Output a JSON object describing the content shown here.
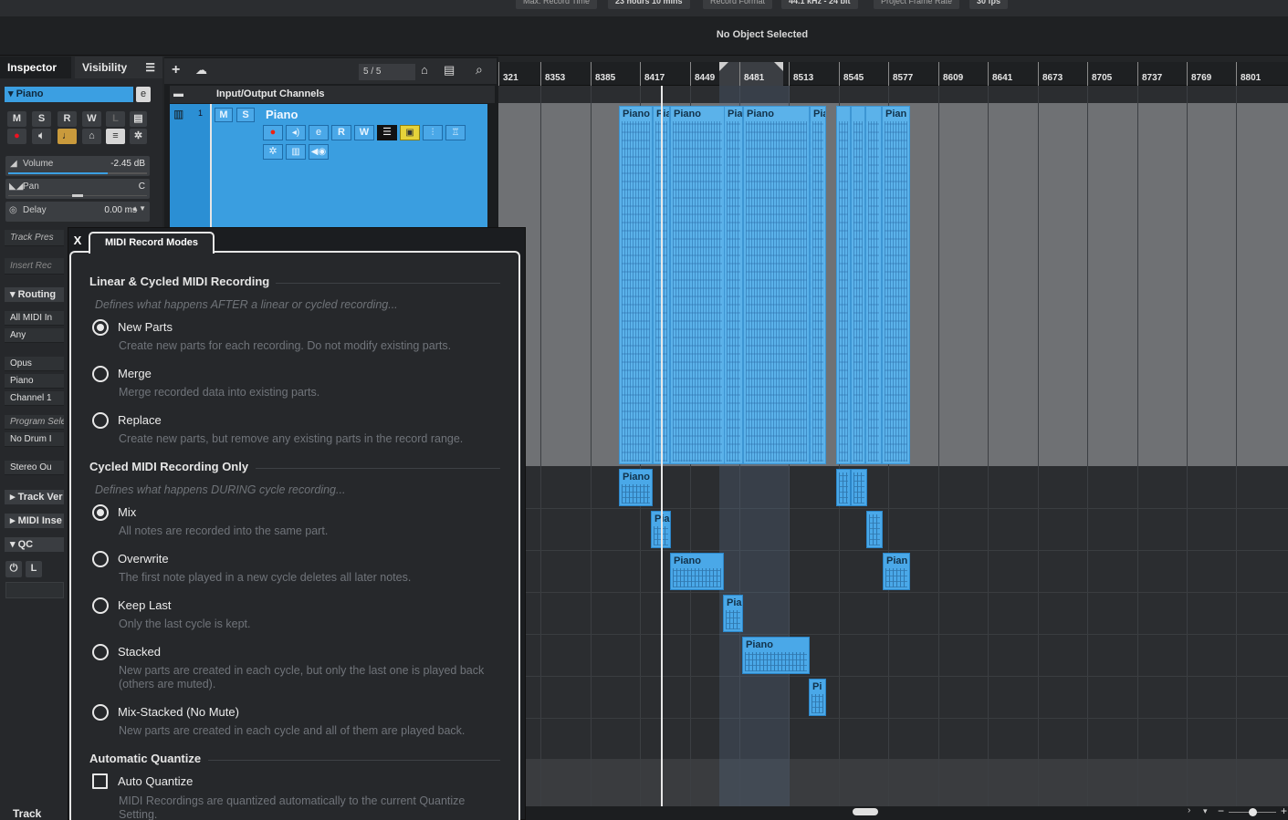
{
  "statusbar": {
    "items": [
      "Max. Record Time",
      "23 hours 10 mins",
      "Record Format",
      "44.1 kHz - 24 bit",
      "Project Frame Rate",
      "30 fps"
    ]
  },
  "infoline": {
    "text": "No Object Selected"
  },
  "inspector": {
    "tab_inspector": "Inspector",
    "tab_visibility": "Visibility",
    "track_name": "Piano",
    "buttons_row1": [
      "M",
      "S",
      "R",
      "W",
      "L"
    ],
    "volume_label": "Volume",
    "volume_value": "-2.45 dB",
    "pan_label": "Pan",
    "pan_value": "C",
    "delay_label": "Delay",
    "delay_value": "0.00 ms",
    "track_preset": "Track Pres",
    "insert_rec": "Insert Rec",
    "routing": "Routing",
    "midi_in": "All MIDI In",
    "channel_any": "Any",
    "opus": "Opus",
    "piano": "Piano",
    "channel1": "Channel 1",
    "program_select": "Program Sele",
    "no_drum": "No Drum I",
    "stereo_out": "Stereo Ou",
    "track_versions": "Track Ver",
    "midi_inserts": "MIDI Inse",
    "qc": "QC",
    "track_footer": "Track"
  },
  "tracklist": {
    "counter": "5 / 5",
    "folder_name": "Input/Output Channels",
    "track_number": "1",
    "track_name": "Piano",
    "m": "M",
    "s": "S",
    "r": "R",
    "w": "W"
  },
  "ruler": {
    "bars": [
      "321",
      "8353",
      "8385",
      "8417",
      "8449",
      "8481",
      "8513",
      "8545",
      "8577",
      "8609",
      "8641",
      "8673",
      "8705",
      "8737",
      "8769",
      "8801"
    ]
  },
  "parts": {
    "lane1": [
      "Piano",
      "Pia",
      "Piano",
      "Pia",
      "Piano",
      "Pia",
      "Pian"
    ],
    "lane2": [
      "Piano"
    ],
    "lane3": [
      "Pia"
    ],
    "lane4a": "Piano",
    "lane4b": "Pian",
    "lane5": "Pia",
    "lane6": "Piano",
    "lane7": "Pi"
  },
  "popup": {
    "close": "X",
    "tab": "MIDI Record Modes",
    "section1_title": "Linear & Cycled MIDI Recording",
    "section1_desc": "Defines what happens AFTER a linear or cycled recording...",
    "options1": [
      {
        "label": "New Parts",
        "hint": "Create new parts for each recording. Do not modify existing parts.",
        "selected": true
      },
      {
        "label": "Merge",
        "hint": "Merge recorded data into existing parts.",
        "selected": false
      },
      {
        "label": "Replace",
        "hint": "Create new parts, but remove any existing parts in the record range.",
        "selected": false
      }
    ],
    "section2_title": "Cycled MIDI Recording Only",
    "section2_desc": "Defines what happens DURING cycle recording...",
    "options2": [
      {
        "label": "Mix",
        "hint": "All notes are recorded into the same part.",
        "selected": true
      },
      {
        "label": "Overwrite",
        "hint": "The first note played in a new cycle deletes all later notes.",
        "selected": false
      },
      {
        "label": "Keep Last",
        "hint": "Only the last cycle is kept.",
        "selected": false
      },
      {
        "label": "Stacked",
        "hint": "New parts are created in each cycle, but only the last one is played back (others are muted).",
        "selected": false
      },
      {
        "label": "Mix-Stacked (No Mute)",
        "hint": "New parts are created in each cycle and all of them are played back.",
        "selected": false
      }
    ],
    "section3_title": "Automatic Quantize",
    "auto_quantize_label": "Auto Quantize",
    "auto_quantize_hint": "MIDI Recordings are quantized automatically to the current Quantize Setting.",
    "auto_quantize_checked": false
  }
}
